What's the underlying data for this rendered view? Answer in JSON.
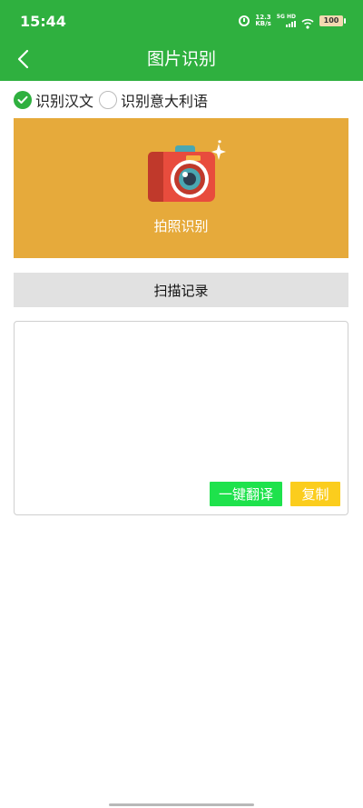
{
  "status_bar": {
    "time": "15:44",
    "net_speed_value": "12.3",
    "net_speed_unit": "KB/s",
    "network": "5G HD",
    "battery": "100",
    "icons": [
      "alarm-icon",
      "signal-icon",
      "wifi-icon",
      "battery-icon"
    ]
  },
  "header": {
    "title": "图片识别",
    "back_icon": "chevron-left-icon",
    "background_color": "#2fb03f"
  },
  "options": [
    {
      "label": "识别汉文",
      "checked": true
    },
    {
      "label": "识别意大利语",
      "checked": false
    }
  ],
  "photo_panel": {
    "label": "拍照识别",
    "icon": "camera-icon",
    "background_color": "#e6aa3b"
  },
  "records_button": {
    "label": "扫描记录"
  },
  "text_area": {
    "value": ""
  },
  "actions": {
    "translate_label": "一键翻译",
    "copy_label": "复制",
    "translate_color": "#1ee24c",
    "copy_color": "#fbcd1d"
  }
}
